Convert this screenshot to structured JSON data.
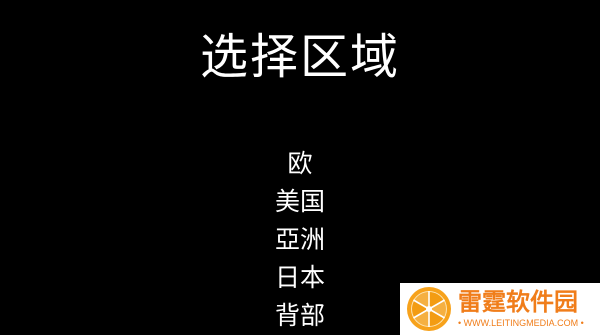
{
  "screen": {
    "title": "选择区域",
    "regions": [
      "欧",
      "美国",
      "亞洲",
      "日本",
      "背部"
    ]
  },
  "watermark": {
    "name": "雷霆软件园",
    "url": "• WWW.LEITINGMEDIA.COM •",
    "brand_color": "#f07d1a"
  },
  "colors": {
    "background": "#000000",
    "text": "#ffffff"
  }
}
